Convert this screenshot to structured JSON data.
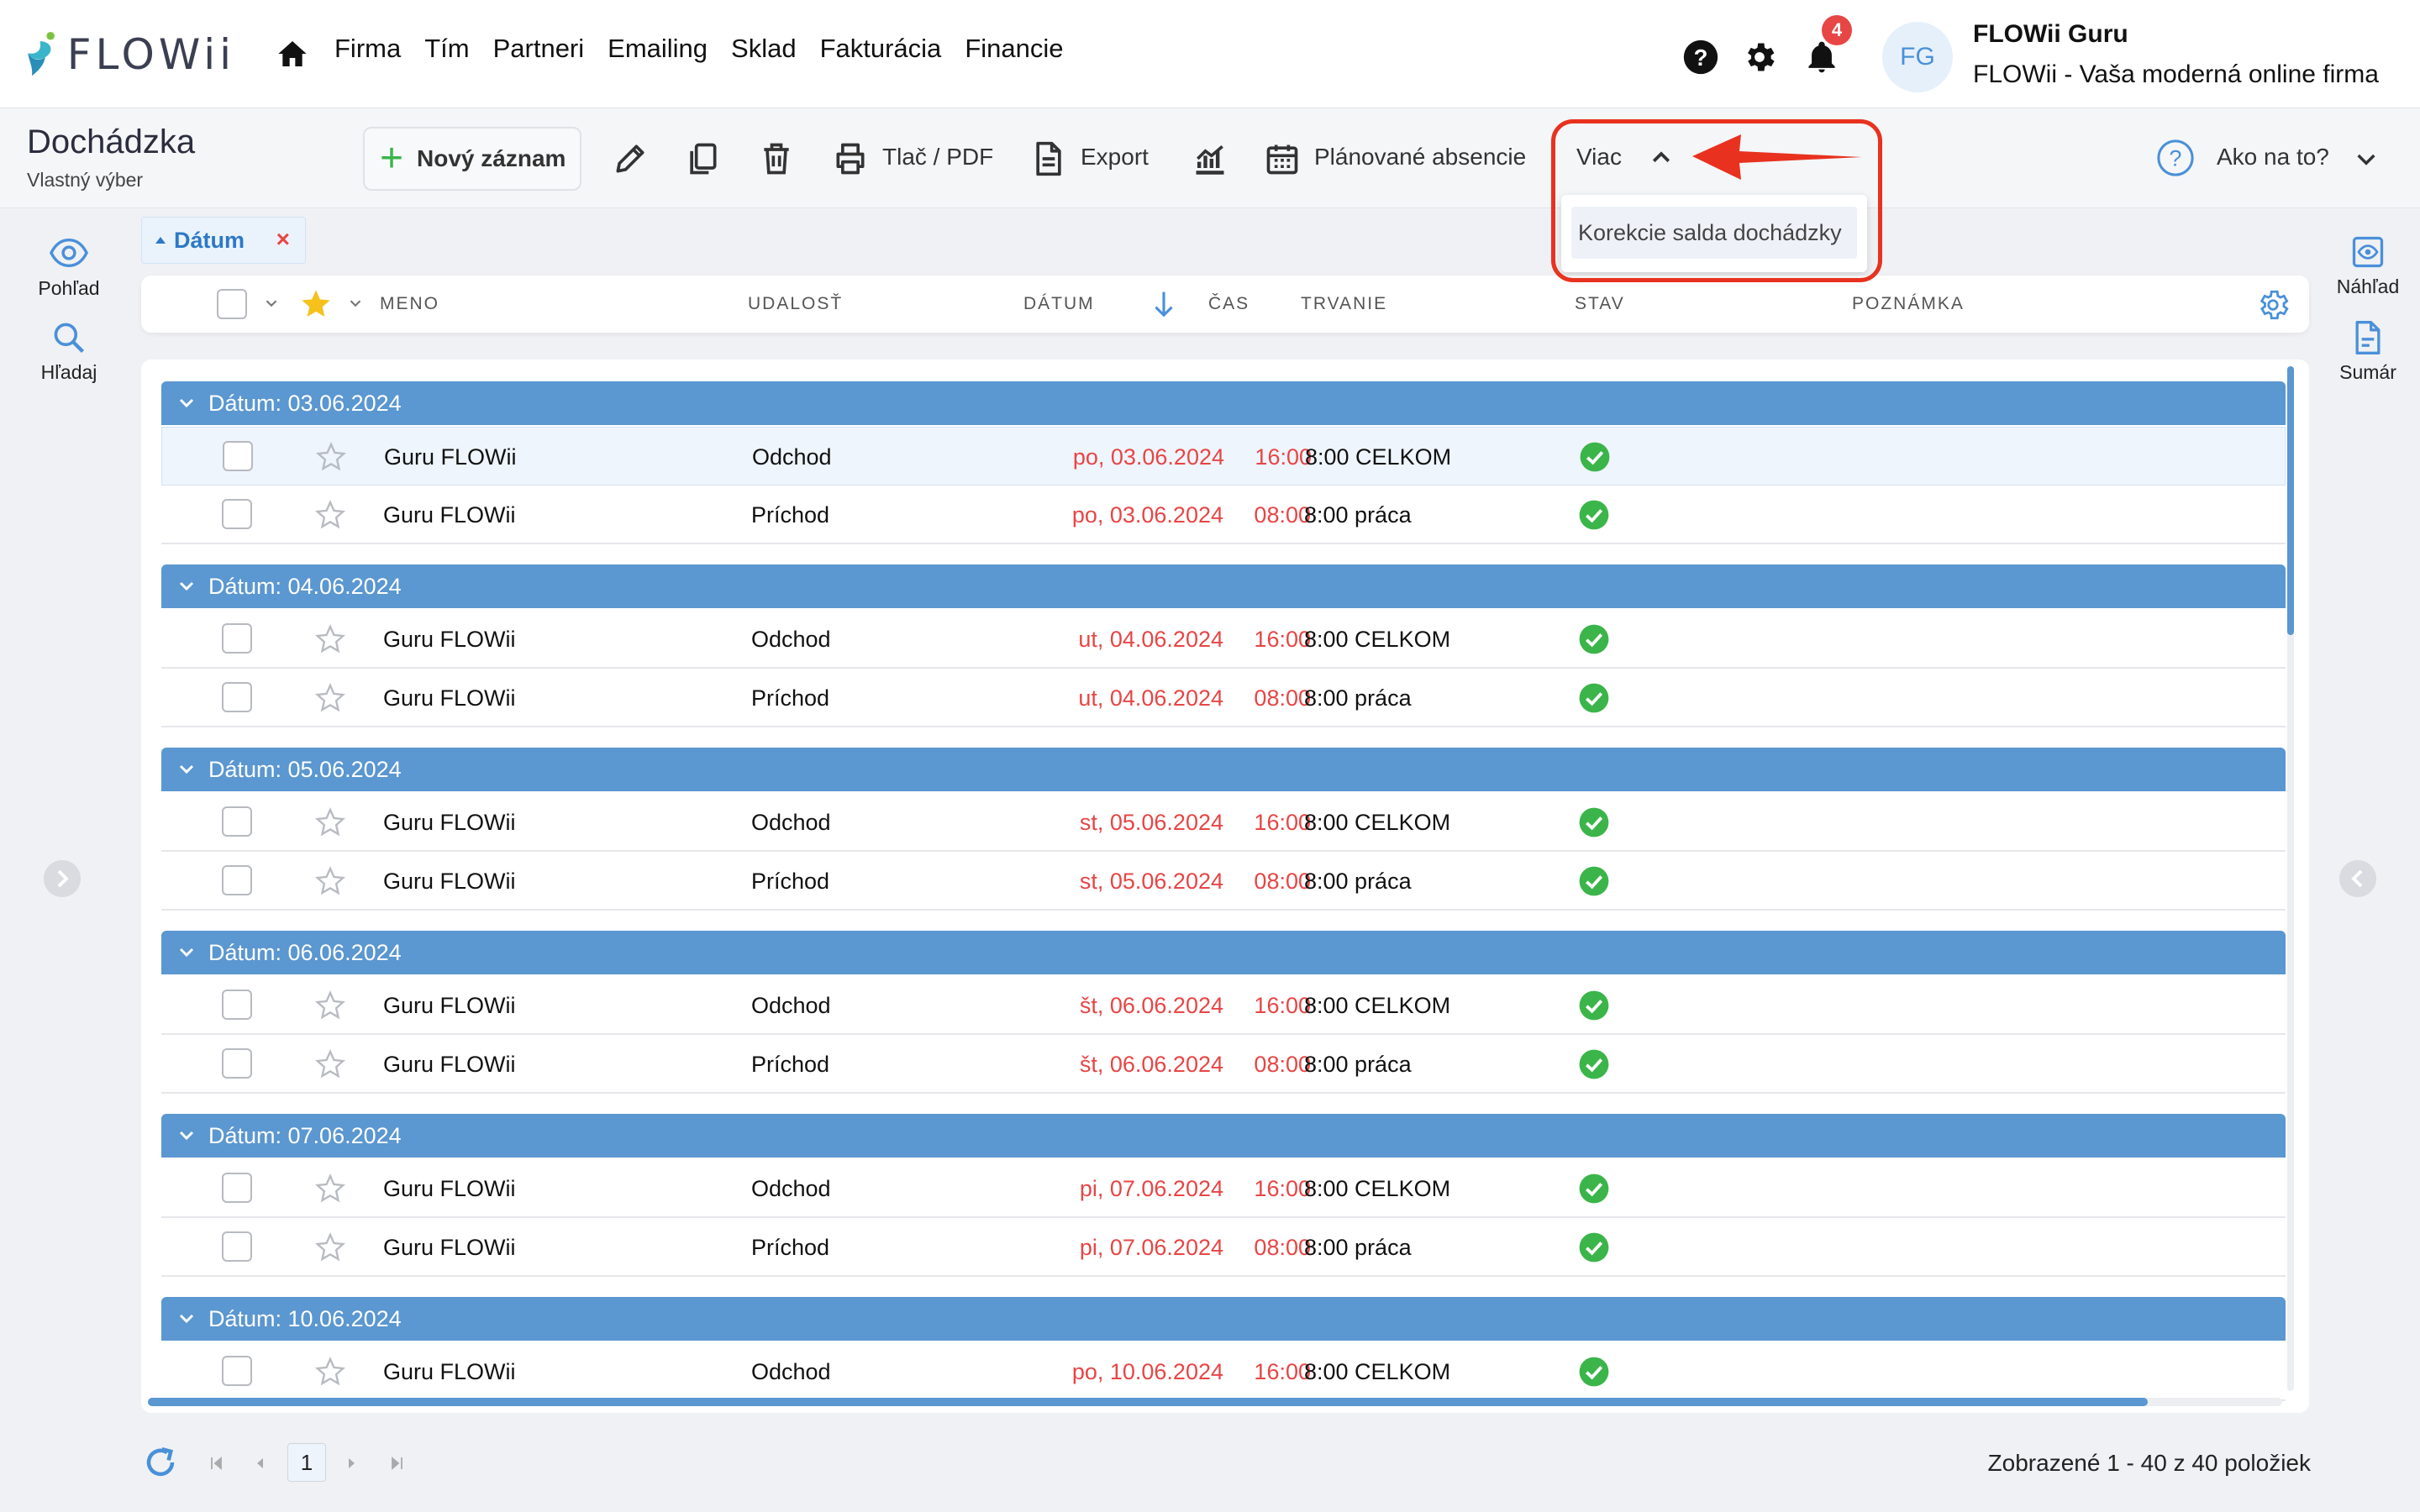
{
  "app": {
    "logo_text": "FLOWii",
    "nav": [
      "Firma",
      "Tím",
      "Partneri",
      "Emailing",
      "Sklad",
      "Fakturácia",
      "Financie"
    ],
    "notifications_count": "4",
    "avatar_initials": "FG",
    "user_name": "FLOWii Guru",
    "company": "FLOWii - Vaša moderná online firma"
  },
  "toolbar": {
    "title": "Dochádzka",
    "subtitle": "Vlastný výber",
    "new_record": "Nový záznam",
    "print": "Tlač / PDF",
    "export": "Export",
    "planned_absences": "Plánované absencie",
    "more": "Viac",
    "more_menu": [
      "Korekcie salda dochádzky"
    ],
    "help": "Ako na to?"
  },
  "rails": {
    "left": [
      "Pohľad",
      "Hľadaj"
    ],
    "right": [
      "Náhľad",
      "Sumár"
    ]
  },
  "filter_chip": "Dátum",
  "columns": {
    "name": "MENO",
    "event": "UDALOSŤ",
    "date": "DÁTUM",
    "time": "ČAS",
    "duration": "TRVANIE",
    "status": "STAV",
    "note": "POZNÁMKA"
  },
  "groups": [
    {
      "label": "Dátum: 03.06.2024",
      "rows": [
        {
          "name": "Guru FLOWii",
          "event": "Odchod",
          "date": "po, 03.06.2024",
          "time": "16:00",
          "duration": "8:00 CELKOM",
          "status": "ok",
          "selected": true
        },
        {
          "name": "Guru FLOWii",
          "event": "Príchod",
          "date": "po, 03.06.2024",
          "time": "08:00",
          "duration": "8:00 práca",
          "status": "ok"
        }
      ]
    },
    {
      "label": "Dátum: 04.06.2024",
      "rows": [
        {
          "name": "Guru FLOWii",
          "event": "Odchod",
          "date": "ut, 04.06.2024",
          "time": "16:00",
          "duration": "8:00 CELKOM",
          "status": "ok"
        },
        {
          "name": "Guru FLOWii",
          "event": "Príchod",
          "date": "ut, 04.06.2024",
          "time": "08:00",
          "duration": "8:00 práca",
          "status": "ok"
        }
      ]
    },
    {
      "label": "Dátum: 05.06.2024",
      "rows": [
        {
          "name": "Guru FLOWii",
          "event": "Odchod",
          "date": "st, 05.06.2024",
          "time": "16:00",
          "duration": "8:00 CELKOM",
          "status": "ok"
        },
        {
          "name": "Guru FLOWii",
          "event": "Príchod",
          "date": "st, 05.06.2024",
          "time": "08:00",
          "duration": "8:00 práca",
          "status": "ok"
        }
      ]
    },
    {
      "label": "Dátum: 06.06.2024",
      "rows": [
        {
          "name": "Guru FLOWii",
          "event": "Odchod",
          "date": "št, 06.06.2024",
          "time": "16:00",
          "duration": "8:00 CELKOM",
          "status": "ok"
        },
        {
          "name": "Guru FLOWii",
          "event": "Príchod",
          "date": "št, 06.06.2024",
          "time": "08:00",
          "duration": "8:00 práca",
          "status": "ok"
        }
      ]
    },
    {
      "label": "Dátum: 07.06.2024",
      "rows": [
        {
          "name": "Guru FLOWii",
          "event": "Odchod",
          "date": "pi, 07.06.2024",
          "time": "16:00",
          "duration": "8:00 CELKOM",
          "status": "ok"
        },
        {
          "name": "Guru FLOWii",
          "event": "Príchod",
          "date": "pi, 07.06.2024",
          "time": "08:00",
          "duration": "8:00 práca",
          "status": "ok"
        }
      ]
    },
    {
      "label": "Dátum: 10.06.2024",
      "rows": [
        {
          "name": "Guru FLOWii",
          "event": "Odchod",
          "date": "po, 10.06.2024",
          "time": "16:00",
          "duration": "8:00 CELKOM",
          "status": "ok"
        }
      ]
    }
  ],
  "pagination": {
    "current_page": "1",
    "summary": "Zobrazené 1 - 40 z 40 položiek"
  },
  "colors": {
    "accent": "#5b97d0",
    "date_red": "#e84545",
    "status_ok": "#3bb54a",
    "annotation_red": "#e8321f"
  }
}
